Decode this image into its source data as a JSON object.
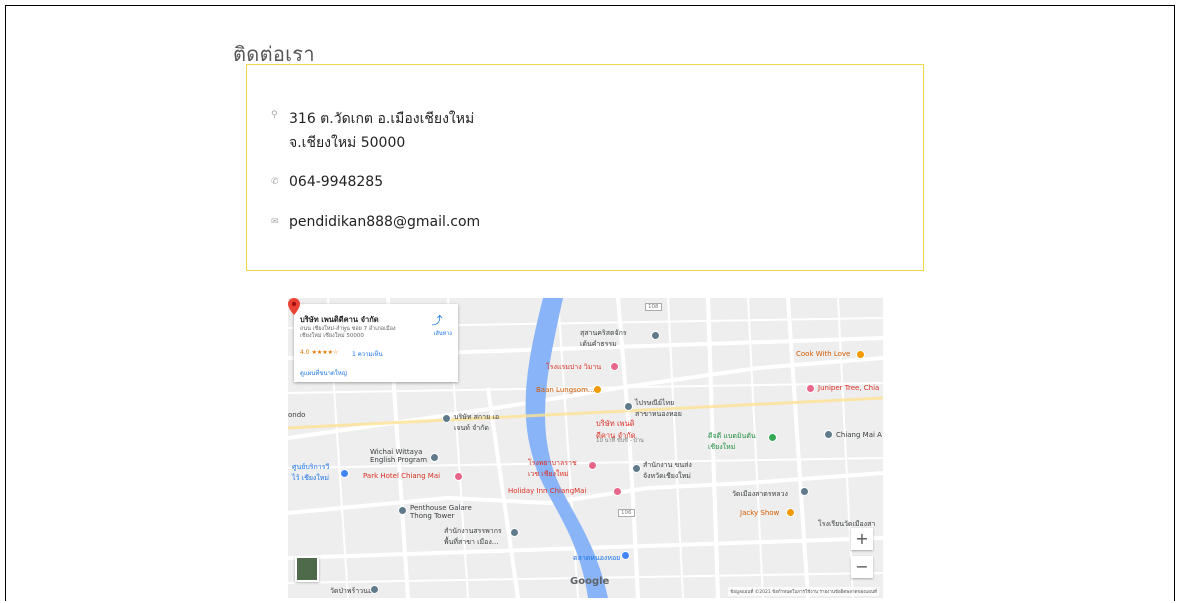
{
  "contact": {
    "title": "ติดต่อเรา",
    "address_line1": "316 ต.วัดเกต อ.เมืองเชียงใหม่",
    "address_line2": "จ.เชียงใหม่ 50000",
    "phone": "064-9948285",
    "email": "pendidikan888@gmail.com",
    "icons": {
      "address": "location-pin-icon",
      "phone": "phone-icon",
      "email": "envelope-icon"
    },
    "box_border_color": "#f0d64a"
  },
  "map": {
    "card": {
      "name": "บริษัท เพนดิดีคาน จำกัด",
      "address": "ถนน เชียงใหม่-ลำพูน ซอย 7 อำเภอเมือง เชียงใหม่ เชียงใหม่ 50000",
      "rating": "4.0 ★★★★☆",
      "reviews": "1 ความเห็น",
      "larger_map": "ดูแผนที่ขนาดใหญ่",
      "directions": "เส้นทาง"
    },
    "labels": {
      "sathan_krit": "สุสานคริสตจักร\nเต้นคำธรรม",
      "rongraem": "โรงแรมปาง วิมาน",
      "baan_lungsom": "Baan Lungsom...",
      "post_office": "ไปรษณีย์ไทย\nสาขาหนองหอย",
      "pendidikan_pin": "บริษัท เพนดิ\nดีคาน จำกัด",
      "pendidikan_sub": "10 นาที ขับขี่ - บ้าน",
      "cook_with_love": "Cook With Love",
      "juniper_tree": "Juniper Tree, Chia",
      "company_sakai": "บริษัท สกาย เอ\nเจนท์ จำกัด",
      "wichai": "Wichai Wittaya\nEnglish Program",
      "service_center": "ศูนย์บริการวี\nไว้ เชียงใหม่",
      "park_hotel": "Park Hotel Chiang Mai",
      "hospital": "โรงพยาบาลราช\nเวช เชียงใหม่",
      "holiday_inn": "Holiday Inn ChiangMai",
      "office_dept": "สำนักงาน ขนส่ง\nจังหวัดเชียงใหม่",
      "badminton": "ดีจดี แบดมินตัน\nเชียงใหม่",
      "chiang_mai_a": "Chiang Mai A",
      "wat_mueang": "วัดเมืองสาตรหลวง",
      "jacky_show": "Jacky Show",
      "penthouse": "Penthouse Galare\nThong Tower",
      "tax_office": "สำนักงานสรรพากร\nพื้นที่สาขา เมือง...",
      "talat": "ตลาดหนองหอย",
      "wat_pa": "วัดป่าพร้าวนอก",
      "school": "โรงเรียนวัดเมืองสา",
      "ondo": "ondo",
      "road_1": "108",
      "road_2": "106",
      "google": "Google",
      "attribution": "ข้อมูลแผนที่ ©2021  ข้อกำหนดในการใช้งาน  รายงานข้อผิดพลาดของแผนที่"
    },
    "controls": {
      "zoom_in": "+",
      "zoom_out": "−"
    },
    "colors": {
      "water": "#8ab4f8",
      "road": "#ffffff",
      "land": "#eeeeee",
      "marker": "#ea4335"
    }
  }
}
